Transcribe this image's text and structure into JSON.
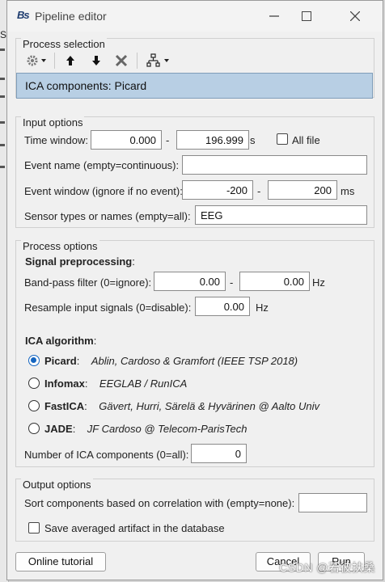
{
  "window": {
    "title": "Pipeline editor",
    "logo": "Bs",
    "controls": {
      "minimize": "minimize-icon",
      "maximize": "maximize-icon",
      "close": "close-icon"
    }
  },
  "background": {
    "letter": "S"
  },
  "process_selection": {
    "title": "Process selection",
    "toolbar_icons": [
      "gear-icon",
      "arrow-up-icon",
      "arrow-down-icon",
      "delete-icon",
      "pipeline-tree-icon"
    ],
    "selected_item": "ICA components: Picard"
  },
  "input_options": {
    "title": "Input options",
    "time_window": {
      "label": "Time window:",
      "start": "0.000",
      "dash": "-",
      "end": "196.999",
      "unit": "s",
      "all_file_label": "All file",
      "all_file_checked": false
    },
    "event_name": {
      "label": "Event name (empty=continuous):",
      "value": ""
    },
    "event_window": {
      "label": "Event window (ignore if no event):",
      "start": "-200",
      "dash": "-",
      "end": "200",
      "unit": "ms"
    },
    "sensor_types": {
      "label": "Sensor types or names (empty=all):",
      "value": "EEG"
    }
  },
  "process_options": {
    "title": "Process options",
    "signal_preprocessing": {
      "heading": "Signal preprocessing",
      "colon": ":"
    },
    "bandpass": {
      "label": "Band-pass filter (0=ignore):",
      "low": "0.00",
      "dash": "-",
      "high": "0.00",
      "unit": "Hz"
    },
    "resample": {
      "label": "Resample input signals (0=disable):",
      "value": "0.00",
      "unit": "Hz"
    },
    "ica_algorithm": {
      "heading": "ICA algorithm",
      "colon": ":"
    },
    "algorithms": [
      {
        "name": "Picard",
        "colon": ":",
        "desc": "Ablin, Cardoso & Gramfort (IEEE TSP 2018)",
        "selected": true
      },
      {
        "name": "Infomax",
        "colon": ":",
        "desc": "EEGLAB / RunICA",
        "selected": false
      },
      {
        "name": "FastICA",
        "colon": ":",
        "desc": "Gävert, Hurri, Särelä & Hyvärinen @ Aalto Univ",
        "selected": false
      },
      {
        "name": "JADE",
        "colon": ":",
        "desc": "JF Cardoso @ Telecom-ParisTech",
        "selected": false
      }
    ],
    "num_components": {
      "label": "Number of ICA components (0=all):",
      "value": "0"
    }
  },
  "output_options": {
    "title": "Output options",
    "sort_components": {
      "label": "Sort components based on correlation with (empty=none):",
      "value": ""
    },
    "save_artifact": {
      "label": "Save averaged artifact in the database",
      "checked": false
    }
  },
  "footer": {
    "tutorial_label": "Online tutorial",
    "cancel_label": "Cancel",
    "run_label": "Run"
  },
  "watermark": "CSDN @若彼扶桑",
  "colors": {
    "selected_row": "#b8cfe4",
    "radio_accent": "#1565c0",
    "logo": "#1d3b6e"
  }
}
